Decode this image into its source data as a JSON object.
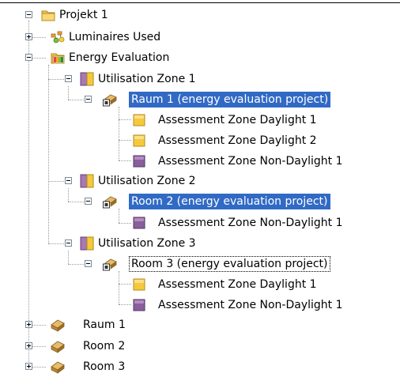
{
  "tree": {
    "root": {
      "label": "Projekt 1",
      "icon": "folder-icon",
      "expanded": true
    },
    "luminaires": {
      "label": "Luminaires Used",
      "icon": "luminaires-icon",
      "expanded": false
    },
    "energy": {
      "label": "Energy Evaluation",
      "icon": "energy-evaluation-icon",
      "expanded": true
    },
    "zone1": {
      "label": "Utilisation Zone 1",
      "icon": "utilisation-zone-icon",
      "expanded": true,
      "room": {
        "label": "Raum 1 (energy evaluation project)",
        "icon": "room-icon",
        "selected": true
      },
      "assessments": [
        {
          "label": "Assessment Zone Daylight 1",
          "icon": "daylight-zone-icon"
        },
        {
          "label": "Assessment Zone Daylight 2",
          "icon": "daylight-zone-icon"
        },
        {
          "label": "Assessment Zone Non-Daylight 1",
          "icon": "non-daylight-zone-icon"
        }
      ]
    },
    "zone2": {
      "label": "Utilisation Zone 2",
      "icon": "utilisation-zone-icon",
      "expanded": true,
      "room": {
        "label": "Room 2 (energy evaluation project)",
        "icon": "room-icon",
        "selected": true
      },
      "assessments": [
        {
          "label": "Assessment Zone Non-Daylight 1",
          "icon": "non-daylight-zone-icon"
        }
      ]
    },
    "zone3": {
      "label": "Utilisation Zone 3",
      "icon": "utilisation-zone-icon",
      "expanded": true,
      "room": {
        "label": "Room 3 (energy evaluation project)",
        "icon": "room-icon",
        "selected": false,
        "focused": true
      },
      "assessments": [
        {
          "label": "Assessment Zone Daylight 1",
          "icon": "daylight-zone-icon"
        },
        {
          "label": "Assessment Zone Non-Daylight 1",
          "icon": "non-daylight-zone-icon"
        }
      ]
    },
    "rooms": [
      {
        "label": "Raum 1",
        "icon": "room-icon",
        "expanded": false
      },
      {
        "label": "Room 2",
        "icon": "room-icon",
        "expanded": false
      },
      {
        "label": "Room 3",
        "icon": "room-icon",
        "expanded": false
      }
    ]
  },
  "colors": {
    "selection": "#316ac5",
    "folder": "#f5c542",
    "daylight": "#f6c93c",
    "non_daylight": "#8b5f9b",
    "room": "#c89a4a"
  }
}
